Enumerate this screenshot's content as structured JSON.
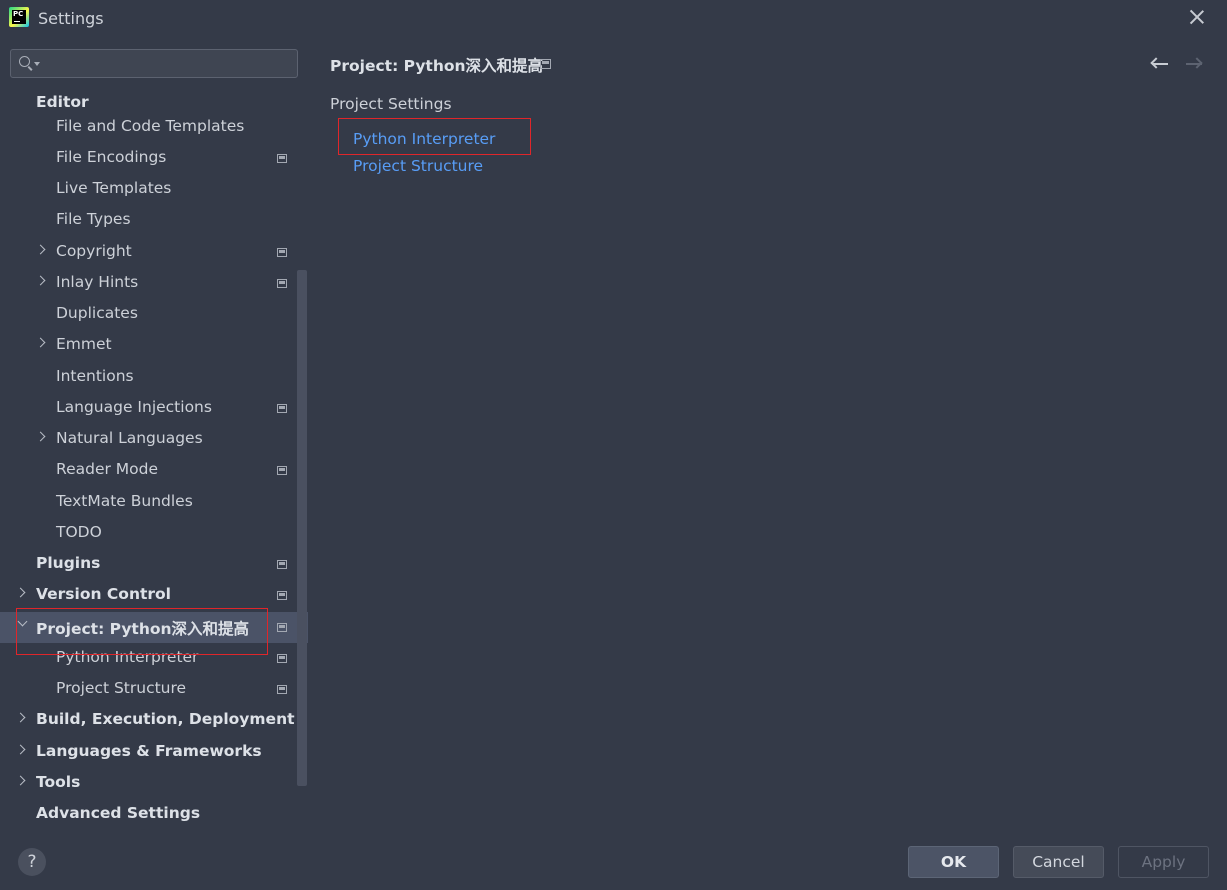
{
  "window": {
    "title": "Settings"
  },
  "search": {
    "placeholder": "",
    "value": ""
  },
  "tree": {
    "items": [
      {
        "label": "Editor"
      },
      {
        "label": "File and Code Templates"
      },
      {
        "label": "File Encodings"
      },
      {
        "label": "Live Templates"
      },
      {
        "label": "File Types"
      },
      {
        "label": "Copyright"
      },
      {
        "label": "Inlay Hints"
      },
      {
        "label": "Duplicates"
      },
      {
        "label": "Emmet"
      },
      {
        "label": "Intentions"
      },
      {
        "label": "Language Injections"
      },
      {
        "label": "Natural Languages"
      },
      {
        "label": "Reader Mode"
      },
      {
        "label": "TextMate Bundles"
      },
      {
        "label": "TODO"
      },
      {
        "label": "Plugins"
      },
      {
        "label": "Version Control"
      },
      {
        "label": "Project: Python深入和提高"
      },
      {
        "label": "Python Interpreter"
      },
      {
        "label": "Project Structure"
      },
      {
        "label": "Build, Execution, Deployment"
      },
      {
        "label": "Languages & Frameworks"
      },
      {
        "label": "Tools"
      },
      {
        "label": "Advanced Settings"
      }
    ]
  },
  "content": {
    "header": "Project: Python深入和提高",
    "section_title": "Project Settings",
    "links": [
      "Python Interpreter",
      "Project Structure"
    ]
  },
  "footer": {
    "help_label": "?",
    "ok_label": "OK",
    "cancel_label": "Cancel",
    "apply_label": "Apply"
  },
  "colors": {
    "background": "#343a48",
    "selection": "#4b5367",
    "link": "#589df6",
    "highlight_box": "#e0262a"
  }
}
